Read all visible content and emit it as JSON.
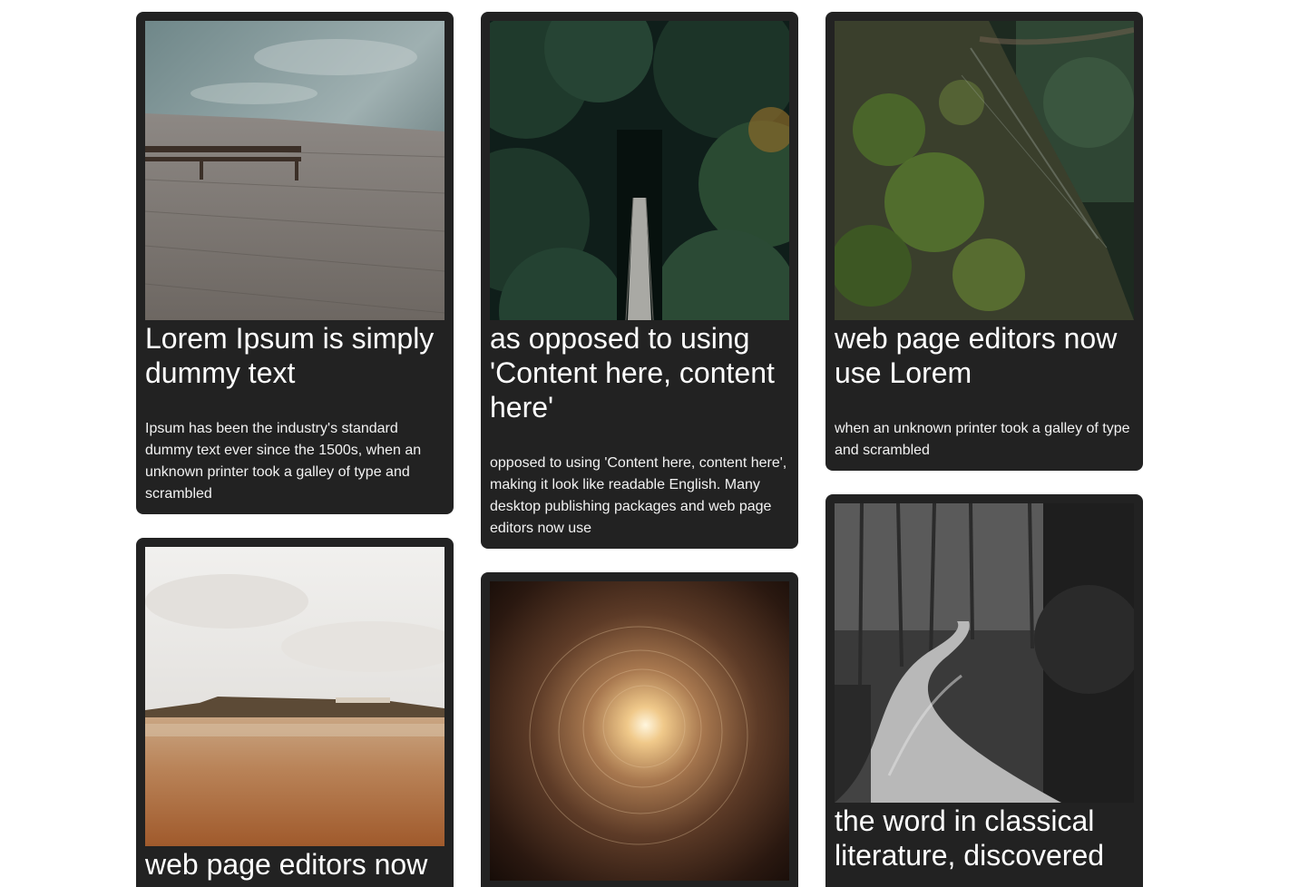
{
  "cards": [
    {
      "image": "lake-pier-bench-photo",
      "title": "Lorem Ipsum is simply dummy text",
      "body": "Ipsum has been the industry's standard dummy text ever since the 1500s, when an unknown printer took a galley of type and scrambled"
    },
    {
      "image": "forest-suspension-bridge-photo",
      "title": "as opposed to using 'Content here, content here'",
      "body": "opposed to using 'Content here, content here', making it look like readable English. Many desktop publishing packages and web page editors now use"
    },
    {
      "image": "mossy-tree-trunk-photo",
      "title": "web page editors now use Lorem",
      "body": "when an unknown printer took a galley of type and scrambled"
    },
    {
      "image": "sepia-beach-coast-photo",
      "title": "web page editors now",
      "body": ""
    },
    {
      "image": "tunnel-light-photo",
      "title": "",
      "body": ""
    },
    {
      "image": "dark-forest-path-photo",
      "title": "the word in classical literature, discovered",
      "body": ""
    }
  ],
  "colors": {
    "card_background": "#222222",
    "card_text": "#ffffff",
    "page_background": "#ffffff"
  }
}
